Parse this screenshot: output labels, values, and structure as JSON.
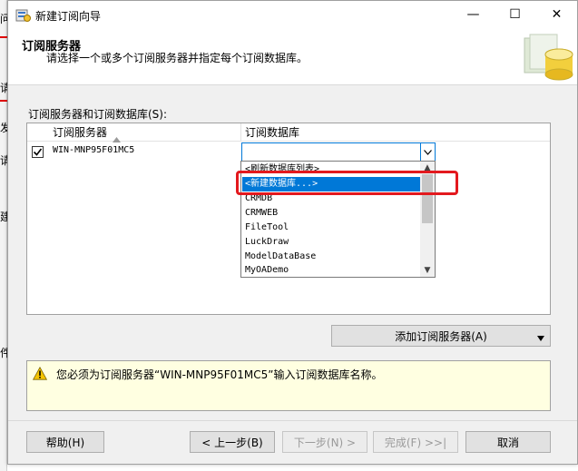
{
  "background": {
    "glyphs": [
      "问",
      "",
      "请",
      "",
      "发",
      "",
      "请",
      "",
      "",
      "",
      "建",
      "",
      "",
      "",
      "件"
    ]
  },
  "window": {
    "title": "新建订阅向导",
    "minimize_glyph": "—",
    "maximize_glyph": "☐",
    "close_glyph": "✕"
  },
  "header": {
    "title": "订阅服务器",
    "description": "请选择一个或多个订阅服务器并指定每个订阅数据库。"
  },
  "section_label": "订阅服务器和订阅数据库(S):",
  "grid": {
    "columns": [
      "订阅服务器",
      "订阅数据库"
    ],
    "sort_glyph": "▲",
    "rows": [
      {
        "checked": true,
        "check_glyph": "✓",
        "server": "WIN-MNP95F01MC5",
        "database": ""
      }
    ],
    "combo_arrow": "∨"
  },
  "dropdown": {
    "items": [
      "<刷新数据库列表>",
      "<新建数据库...>",
      "CRMDB",
      "CRMWEB",
      "FileTool",
      "LuckDraw",
      "ModelDataBase",
      "MyOADemo"
    ],
    "selected_index": 1,
    "scroll_up": "▲",
    "scroll_down": "▼"
  },
  "buttons": {
    "add_subscriber": "添加订阅服务器(A)",
    "add_caret": "▼",
    "help": "帮助(H)",
    "back": "< 上一步(B)",
    "next": "下一步(N) >",
    "finish": "完成(F) >>|",
    "cancel": "取消"
  },
  "message": {
    "text": "您必须为订阅服务器“WIN-MNP95F01MC5”输入订阅数据库名称。"
  },
  "colors": {
    "accent": "#0078d7",
    "highlight_box": "#e3191e",
    "message_bg": "#ffffe1"
  }
}
